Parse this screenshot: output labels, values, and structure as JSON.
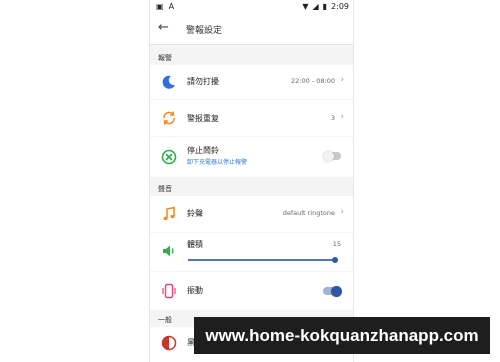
{
  "status_bar": {
    "left_icons": [
      "image-icon",
      "a-icon"
    ],
    "time": "2:09"
  },
  "app_bar": {
    "title": "警報設定"
  },
  "sections": {
    "alarm": "報警",
    "sound": "聲音",
    "general": "一般"
  },
  "rows": {
    "dnd": {
      "label": "請勿打擾",
      "value": "22:00 - 08:00"
    },
    "repeat": {
      "label": "警报重复",
      "value": "3"
    },
    "stop": {
      "label": "停止鬧鈴",
      "sub": "卸下充電器以停止報警",
      "on": false
    },
    "ringtone": {
      "label": "鈴聲",
      "value": "default ringtone"
    },
    "volume": {
      "label": "體積",
      "value": "15",
      "level": 1.0
    },
    "vibrate": {
      "label": "振動",
      "on": true
    },
    "dark": {
      "label": "黑暗主題",
      "on": false
    }
  },
  "banner": {
    "text": "www.home-kokquanzhanapp.com"
  },
  "colors": {
    "accent": "#3a62b0",
    "moon": "#2f6fe0",
    "orange": "#f08a24",
    "green": "#2fae4a",
    "pink": "#e0457b"
  }
}
